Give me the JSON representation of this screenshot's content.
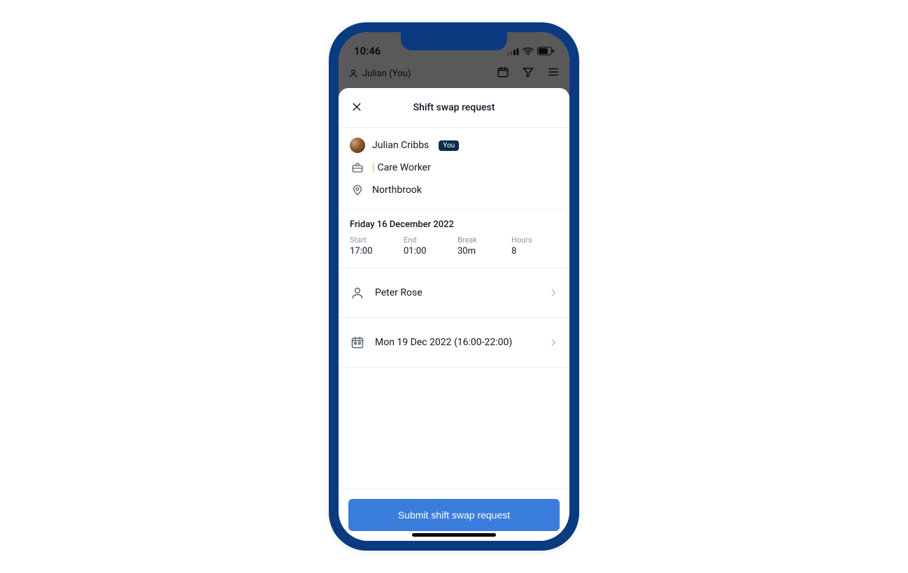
{
  "statusbar": {
    "time": "10:46"
  },
  "bg_header": {
    "user_label": "Julian (You)"
  },
  "sheet": {
    "title": "Shift swap request",
    "user": {
      "name": "Julian Cribbs",
      "you_badge": "You",
      "role": "Care Worker",
      "location": "Northbrook"
    },
    "shift": {
      "date_label": "Friday 16 December 2022",
      "labels": {
        "start": "Start",
        "end": "End",
        "break": "Break",
        "hours": "Hours"
      },
      "values": {
        "start": "17:00",
        "end": "01:00",
        "break": "30m",
        "hours": "8"
      }
    },
    "swap_with": {
      "name": "Peter Rose"
    },
    "swap_shift": {
      "label": "Mon 19 Dec 2022 (16:00-22:00)"
    },
    "submit_label": "Submit shift swap request"
  }
}
